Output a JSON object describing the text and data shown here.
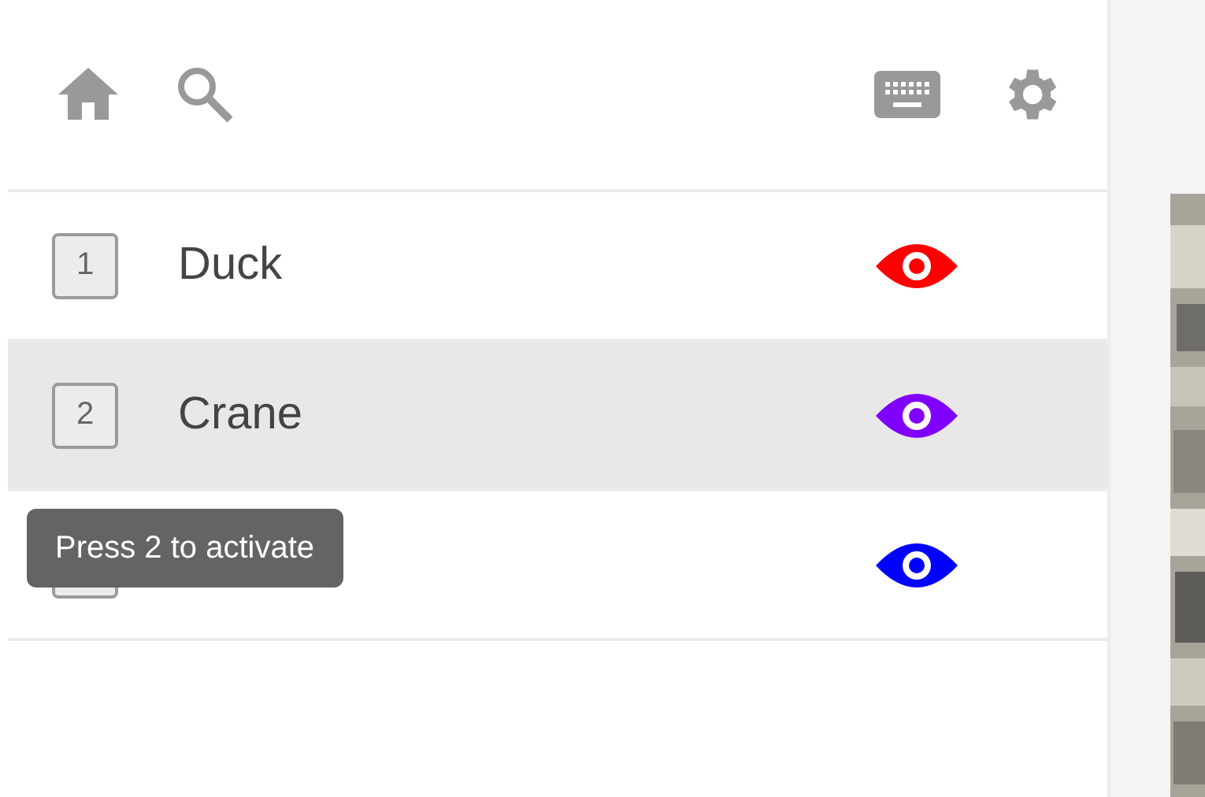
{
  "toolbar": {
    "buttons": [
      {
        "kind": "home"
      },
      {
        "kind": "search"
      },
      {
        "kind": "keyboard"
      },
      {
        "kind": "settings"
      }
    ]
  },
  "items": [
    {
      "key": "1",
      "name": "Duck",
      "color": "#ff0000",
      "selected": false
    },
    {
      "key": "2",
      "name": "Crane",
      "color": "#8000ff",
      "selected": true
    },
    {
      "color": "#0000ff",
      "selected": false
    }
  ],
  "tooltip": {
    "text": "Press 2 to activate"
  }
}
